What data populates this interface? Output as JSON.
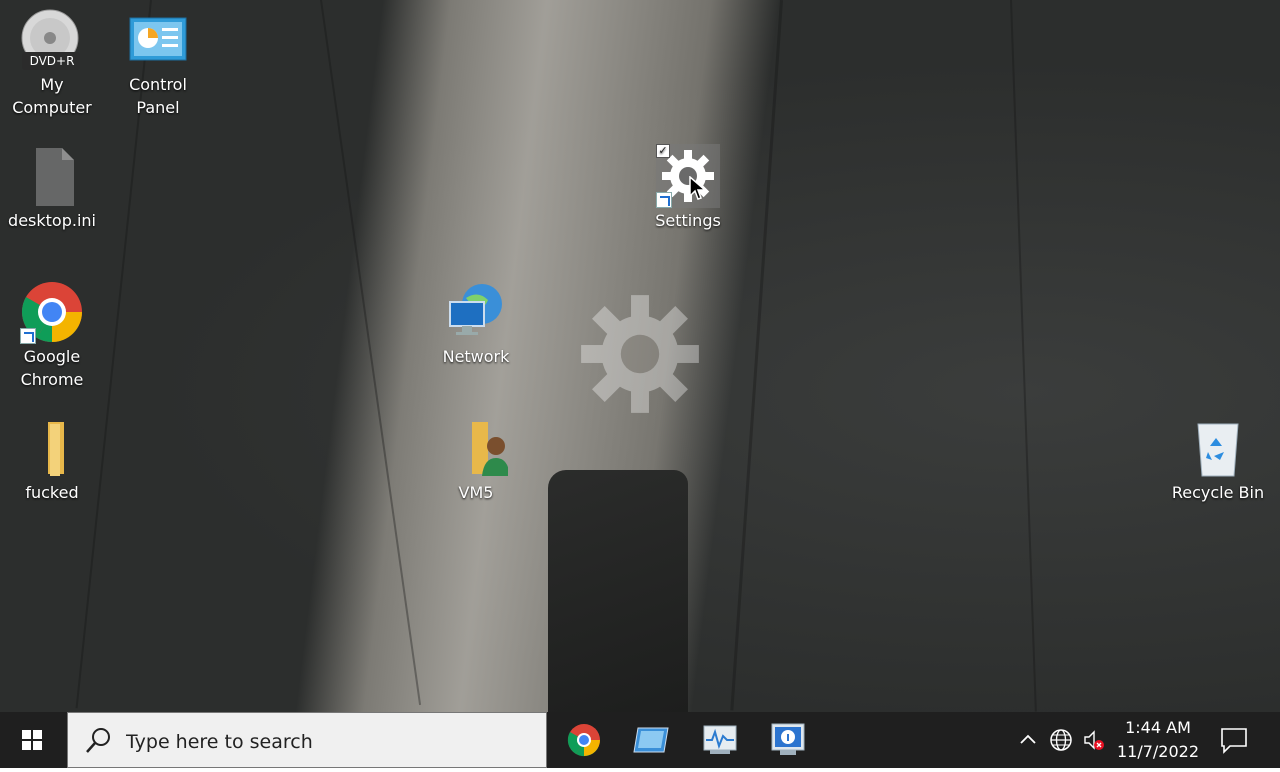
{
  "desktop": {
    "icons": [
      {
        "label": "My\nComputer",
        "badge": "DVD+R",
        "icon": "dvd-drive-icon"
      },
      {
        "label": "Control\nPanel",
        "icon": "control-panel-icon"
      },
      {
        "label": "desktop.ini",
        "icon": "ini-file-icon"
      },
      {
        "label": "Settings",
        "icon": "settings-gear-icon"
      },
      {
        "label": "Google\nChrome",
        "icon": "chrome-icon"
      },
      {
        "label": "Network",
        "icon": "network-icon"
      },
      {
        "label": "fucked",
        "icon": "folder-icon"
      },
      {
        "label": "VM5",
        "icon": "user-folder-icon"
      },
      {
        "label": "Recycle Bin",
        "icon": "recycle-bin-icon"
      }
    ]
  },
  "taskbar": {
    "search_placeholder": "Type here to search",
    "pinned": [
      "chrome-icon",
      "remote-desktop-icon",
      "resource-monitor-icon",
      "system-info-icon"
    ],
    "tray": [
      "chevron-up-icon",
      "globe-network-icon",
      "volume-muted-icon"
    ],
    "time": "1:44 AM",
    "date": "11/7/2022"
  },
  "colors": {
    "taskbar_bg": "#1f1f1f",
    "search_bg": "#f0f0f0",
    "accent": "#1f6fd1"
  }
}
